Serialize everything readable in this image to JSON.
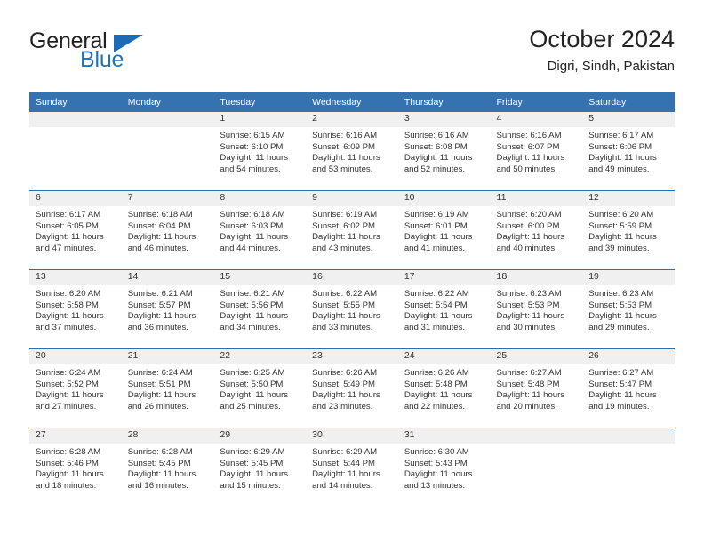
{
  "brand": {
    "name_part1": "General",
    "name_part2": "Blue",
    "logo_icon": "triangle-logo-icon",
    "accent_color": "#1c75bc"
  },
  "header": {
    "title": "October 2024",
    "subtitle": "Digri, Sindh, Pakistan"
  },
  "colors": {
    "header_blue": "#3572b0",
    "row_divider_blue": "#2f6eae",
    "daynum_band": "#f0f0f0",
    "text": "#333333"
  },
  "calendar": {
    "weekday_headers": [
      "Sunday",
      "Monday",
      "Tuesday",
      "Wednesday",
      "Thursday",
      "Friday",
      "Saturday"
    ],
    "weeks": [
      [
        {
          "day": "",
          "lines": []
        },
        {
          "day": "",
          "lines": []
        },
        {
          "day": "1",
          "lines": [
            "Sunrise: 6:15 AM",
            "Sunset: 6:10 PM",
            "Daylight: 11 hours",
            "and 54 minutes."
          ]
        },
        {
          "day": "2",
          "lines": [
            "Sunrise: 6:16 AM",
            "Sunset: 6:09 PM",
            "Daylight: 11 hours",
            "and 53 minutes."
          ]
        },
        {
          "day": "3",
          "lines": [
            "Sunrise: 6:16 AM",
            "Sunset: 6:08 PM",
            "Daylight: 11 hours",
            "and 52 minutes."
          ]
        },
        {
          "day": "4",
          "lines": [
            "Sunrise: 6:16 AM",
            "Sunset: 6:07 PM",
            "Daylight: 11 hours",
            "and 50 minutes."
          ]
        },
        {
          "day": "5",
          "lines": [
            "Sunrise: 6:17 AM",
            "Sunset: 6:06 PM",
            "Daylight: 11 hours",
            "and 49 minutes."
          ]
        }
      ],
      [
        {
          "day": "6",
          "lines": [
            "Sunrise: 6:17 AM",
            "Sunset: 6:05 PM",
            "Daylight: 11 hours",
            "and 47 minutes."
          ]
        },
        {
          "day": "7",
          "lines": [
            "Sunrise: 6:18 AM",
            "Sunset: 6:04 PM",
            "Daylight: 11 hours",
            "and 46 minutes."
          ]
        },
        {
          "day": "8",
          "lines": [
            "Sunrise: 6:18 AM",
            "Sunset: 6:03 PM",
            "Daylight: 11 hours",
            "and 44 minutes."
          ]
        },
        {
          "day": "9",
          "lines": [
            "Sunrise: 6:19 AM",
            "Sunset: 6:02 PM",
            "Daylight: 11 hours",
            "and 43 minutes."
          ]
        },
        {
          "day": "10",
          "lines": [
            "Sunrise: 6:19 AM",
            "Sunset: 6:01 PM",
            "Daylight: 11 hours",
            "and 41 minutes."
          ]
        },
        {
          "day": "11",
          "lines": [
            "Sunrise: 6:20 AM",
            "Sunset: 6:00 PM",
            "Daylight: 11 hours",
            "and 40 minutes."
          ]
        },
        {
          "day": "12",
          "lines": [
            "Sunrise: 6:20 AM",
            "Sunset: 5:59 PM",
            "Daylight: 11 hours",
            "and 39 minutes."
          ]
        }
      ],
      [
        {
          "day": "13",
          "lines": [
            "Sunrise: 6:20 AM",
            "Sunset: 5:58 PM",
            "Daylight: 11 hours",
            "and 37 minutes."
          ]
        },
        {
          "day": "14",
          "lines": [
            "Sunrise: 6:21 AM",
            "Sunset: 5:57 PM",
            "Daylight: 11 hours",
            "and 36 minutes."
          ]
        },
        {
          "day": "15",
          "lines": [
            "Sunrise: 6:21 AM",
            "Sunset: 5:56 PM",
            "Daylight: 11 hours",
            "and 34 minutes."
          ]
        },
        {
          "day": "16",
          "lines": [
            "Sunrise: 6:22 AM",
            "Sunset: 5:55 PM",
            "Daylight: 11 hours",
            "and 33 minutes."
          ]
        },
        {
          "day": "17",
          "lines": [
            "Sunrise: 6:22 AM",
            "Sunset: 5:54 PM",
            "Daylight: 11 hours",
            "and 31 minutes."
          ]
        },
        {
          "day": "18",
          "lines": [
            "Sunrise: 6:23 AM",
            "Sunset: 5:53 PM",
            "Daylight: 11 hours",
            "and 30 minutes."
          ]
        },
        {
          "day": "19",
          "lines": [
            "Sunrise: 6:23 AM",
            "Sunset: 5:53 PM",
            "Daylight: 11 hours",
            "and 29 minutes."
          ]
        }
      ],
      [
        {
          "day": "20",
          "lines": [
            "Sunrise: 6:24 AM",
            "Sunset: 5:52 PM",
            "Daylight: 11 hours",
            "and 27 minutes."
          ]
        },
        {
          "day": "21",
          "lines": [
            "Sunrise: 6:24 AM",
            "Sunset: 5:51 PM",
            "Daylight: 11 hours",
            "and 26 minutes."
          ]
        },
        {
          "day": "22",
          "lines": [
            "Sunrise: 6:25 AM",
            "Sunset: 5:50 PM",
            "Daylight: 11 hours",
            "and 25 minutes."
          ]
        },
        {
          "day": "23",
          "lines": [
            "Sunrise: 6:26 AM",
            "Sunset: 5:49 PM",
            "Daylight: 11 hours",
            "and 23 minutes."
          ]
        },
        {
          "day": "24",
          "lines": [
            "Sunrise: 6:26 AM",
            "Sunset: 5:48 PM",
            "Daylight: 11 hours",
            "and 22 minutes."
          ]
        },
        {
          "day": "25",
          "lines": [
            "Sunrise: 6:27 AM",
            "Sunset: 5:48 PM",
            "Daylight: 11 hours",
            "and 20 minutes."
          ]
        },
        {
          "day": "26",
          "lines": [
            "Sunrise: 6:27 AM",
            "Sunset: 5:47 PM",
            "Daylight: 11 hours",
            "and 19 minutes."
          ]
        }
      ],
      [
        {
          "day": "27",
          "lines": [
            "Sunrise: 6:28 AM",
            "Sunset: 5:46 PM",
            "Daylight: 11 hours",
            "and 18 minutes."
          ]
        },
        {
          "day": "28",
          "lines": [
            "Sunrise: 6:28 AM",
            "Sunset: 5:45 PM",
            "Daylight: 11 hours",
            "and 16 minutes."
          ]
        },
        {
          "day": "29",
          "lines": [
            "Sunrise: 6:29 AM",
            "Sunset: 5:45 PM",
            "Daylight: 11 hours",
            "and 15 minutes."
          ]
        },
        {
          "day": "30",
          "lines": [
            "Sunrise: 6:29 AM",
            "Sunset: 5:44 PM",
            "Daylight: 11 hours",
            "and 14 minutes."
          ]
        },
        {
          "day": "31",
          "lines": [
            "Sunrise: 6:30 AM",
            "Sunset: 5:43 PM",
            "Daylight: 11 hours",
            "and 13 minutes."
          ]
        },
        {
          "day": "",
          "lines": []
        },
        {
          "day": "",
          "lines": []
        }
      ]
    ]
  }
}
